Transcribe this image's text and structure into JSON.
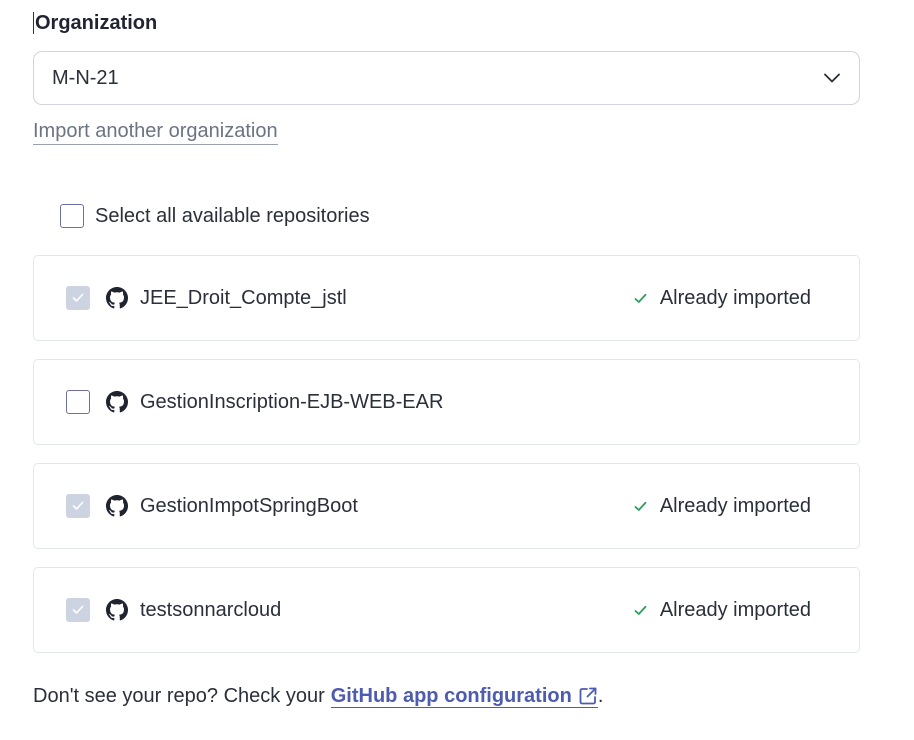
{
  "organization": {
    "label": "Organization",
    "selected": "M-N-21",
    "import_link": "Import another organization"
  },
  "select_all": {
    "label": "Select all available repositories",
    "checked": false
  },
  "repositories": [
    {
      "name": "JEE_Droit_Compte_jstl",
      "status": "Already imported",
      "imported": true
    },
    {
      "name": "GestionInscription-EJB-WEB-EAR",
      "status": "",
      "imported": false
    },
    {
      "name": "GestionImpotSpringBoot",
      "status": "Already imported",
      "imported": true
    },
    {
      "name": "testsonnarcloud",
      "status": "Already imported",
      "imported": true
    }
  ],
  "footer": {
    "text": "Don't see your repo? Check your",
    "link_label": "GitHub app configuration",
    "suffix": "."
  },
  "colors": {
    "accent": "#4d5bb0",
    "success": "#2e9e5b",
    "disabled_checkbox": "#cdd3e1",
    "border": "#e3e6ec"
  },
  "icons": {
    "repo": "github-icon",
    "status": "check-icon",
    "dropdown": "chevron-down-icon",
    "external": "external-link-icon"
  }
}
